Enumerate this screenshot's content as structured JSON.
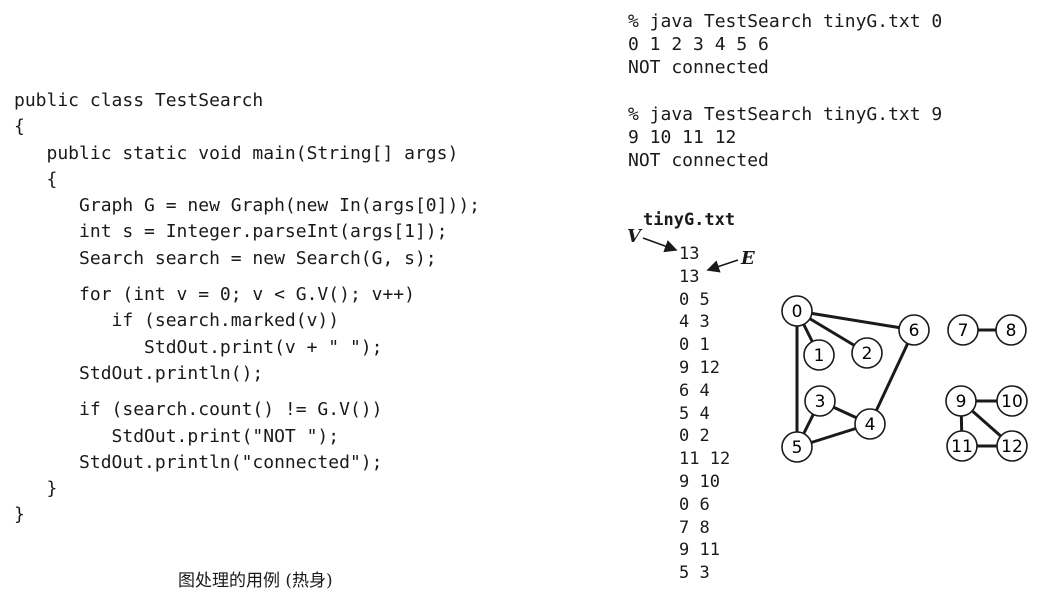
{
  "code": {
    "lines": [
      "public class TestSearch",
      "{",
      "   public static void main(String[] args)",
      "   {",
      "      Graph G = new Graph(new In(args[0]));",
      "      int s = Integer.parseInt(args[1]);",
      "      Search search = new Search(G, s);",
      "",
      "      for (int v = 0; v < G.V(); v++)",
      "         if (search.marked(v))",
      "            StdOut.print(v + \" \");",
      "      StdOut.println();",
      "",
      "      if (search.count() != G.V())",
      "         StdOut.print(\"NOT \");",
      "      StdOut.println(\"connected\");",
      "   }",
      "}"
    ]
  },
  "caption": "图处理的用例 (热身)",
  "session": {
    "runs": [
      {
        "command": "% java TestSearch tinyG.txt 0",
        "output": "0 1 2 3 4 5 6",
        "result": "NOT connected"
      },
      {
        "command": "% java TestSearch tinyG.txt 9",
        "output": "9 10 11 12",
        "result": "NOT connected"
      }
    ]
  },
  "file": {
    "title": "tinyG.txt",
    "v_label": "V",
    "e_label": "E",
    "lines": [
      "13",
      "13",
      "0 5",
      "4 3",
      "0 1",
      "9 12",
      "6 4",
      "5 4",
      "0 2",
      "11 12",
      "9 10",
      "0 6",
      "7 8",
      "9 11",
      "5 3"
    ]
  },
  "graph": {
    "nodes": [
      "0",
      "1",
      "2",
      "3",
      "4",
      "5",
      "6",
      "7",
      "8",
      "9",
      "10",
      "11",
      "12"
    ],
    "edges": [
      [
        "0",
        "5"
      ],
      [
        "4",
        "3"
      ],
      [
        "0",
        "1"
      ],
      [
        "9",
        "12"
      ],
      [
        "6",
        "4"
      ],
      [
        "5",
        "4"
      ],
      [
        "0",
        "2"
      ],
      [
        "11",
        "12"
      ],
      [
        "9",
        "10"
      ],
      [
        "0",
        "6"
      ],
      [
        "7",
        "8"
      ],
      [
        "9",
        "11"
      ],
      [
        "5",
        "3"
      ]
    ]
  }
}
